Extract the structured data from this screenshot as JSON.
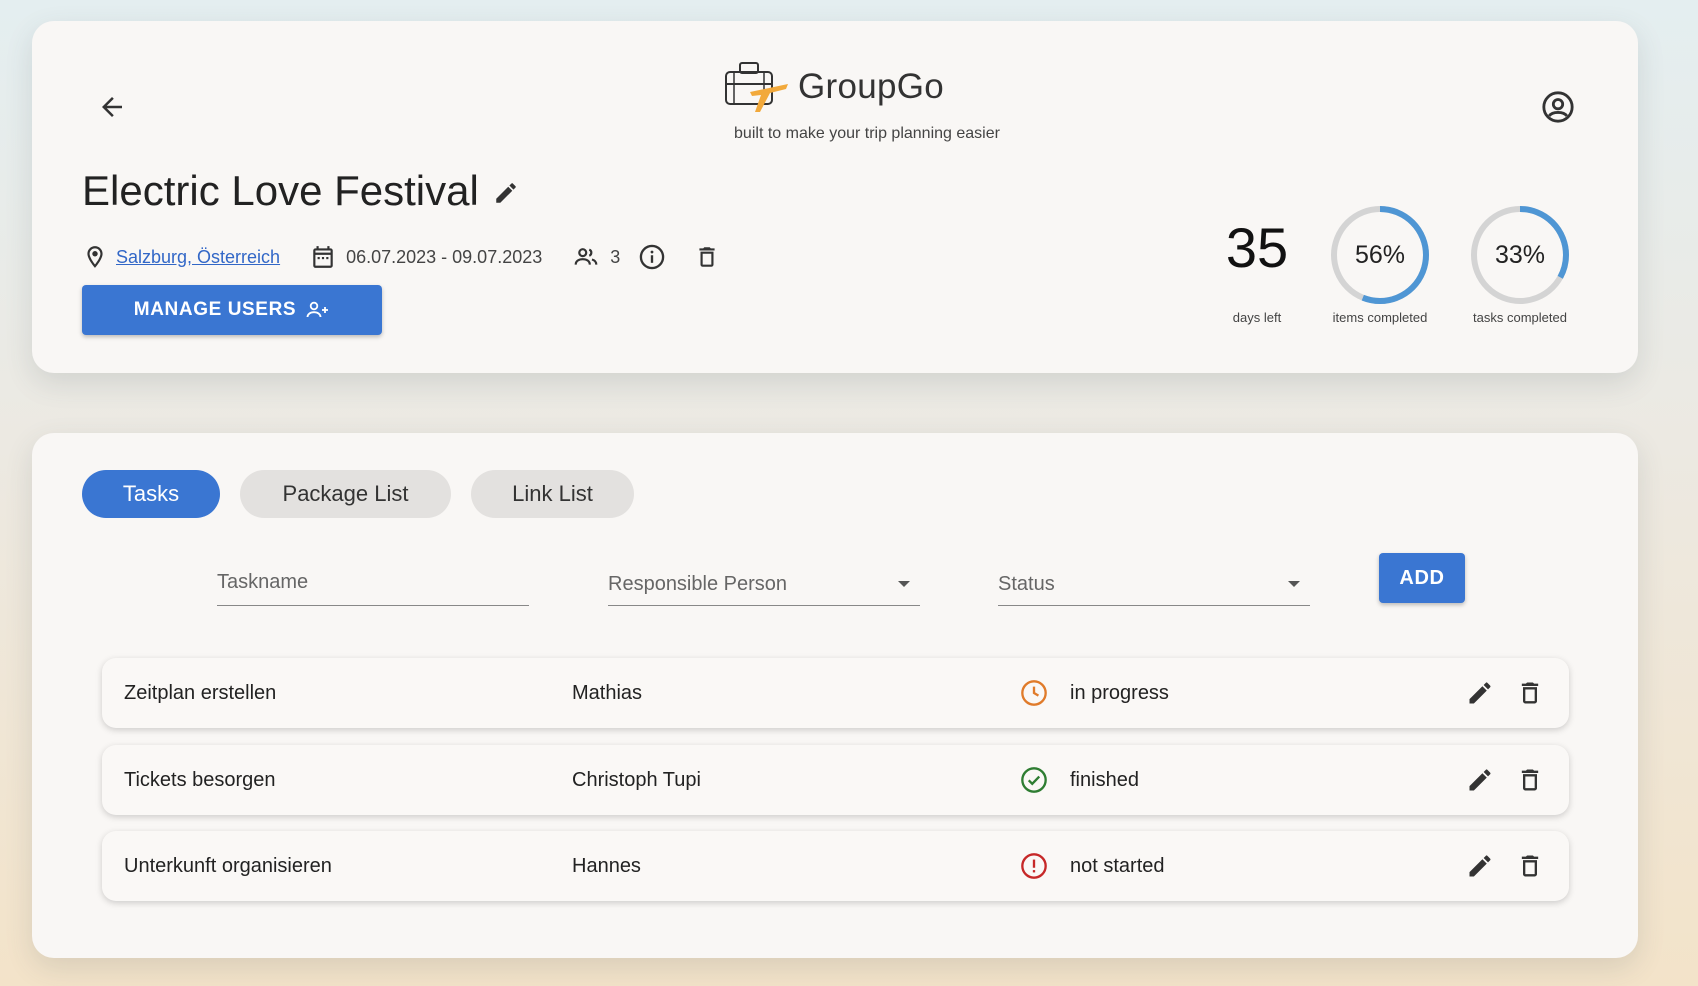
{
  "app": {
    "name": "GroupGo",
    "tagline": "built to make your trip planning easier"
  },
  "trip": {
    "title": "Electric Love Festival",
    "location": "Salzburg, Österreich",
    "dates": "06.07.2023 - 09.07.2023",
    "member_count": "3",
    "manage_users_label": "MANAGE USERS"
  },
  "stats": {
    "days_left": "35",
    "days_left_caption": "days left",
    "items_completed_pct": 56,
    "items_completed_label": "56%",
    "items_completed_caption": "items completed",
    "tasks_completed_pct": 33,
    "tasks_completed_label": "33%",
    "tasks_completed_caption": "tasks completed"
  },
  "tabs": [
    {
      "label": "Tasks",
      "active": true
    },
    {
      "label": "Package List",
      "active": false
    },
    {
      "label": "Link List",
      "active": false
    }
  ],
  "form": {
    "taskname_placeholder": "Taskname",
    "responsible_placeholder": "Responsible Person",
    "status_placeholder": "Status",
    "add_label": "ADD"
  },
  "tasks": [
    {
      "name": "Zeitplan erstellen",
      "person": "Mathias",
      "status": "in progress",
      "status_icon": "clock-icon",
      "status_color": "#e07b2a"
    },
    {
      "name": "Tickets besorgen",
      "person": "Christoph Tupi",
      "status": "finished",
      "status_icon": "check-circle-icon",
      "status_color": "#2e7d32"
    },
    {
      "name": "Unterkunft organisieren",
      "person": "Hannes",
      "status": "not started",
      "status_icon": "alert-circle-icon",
      "status_color": "#c62828"
    }
  ],
  "colors": {
    "accent": "#3a76d2",
    "progress_arc": "#4f96d4",
    "progress_track": "#d4d4d4",
    "logo_plane": "#f2a93b"
  }
}
